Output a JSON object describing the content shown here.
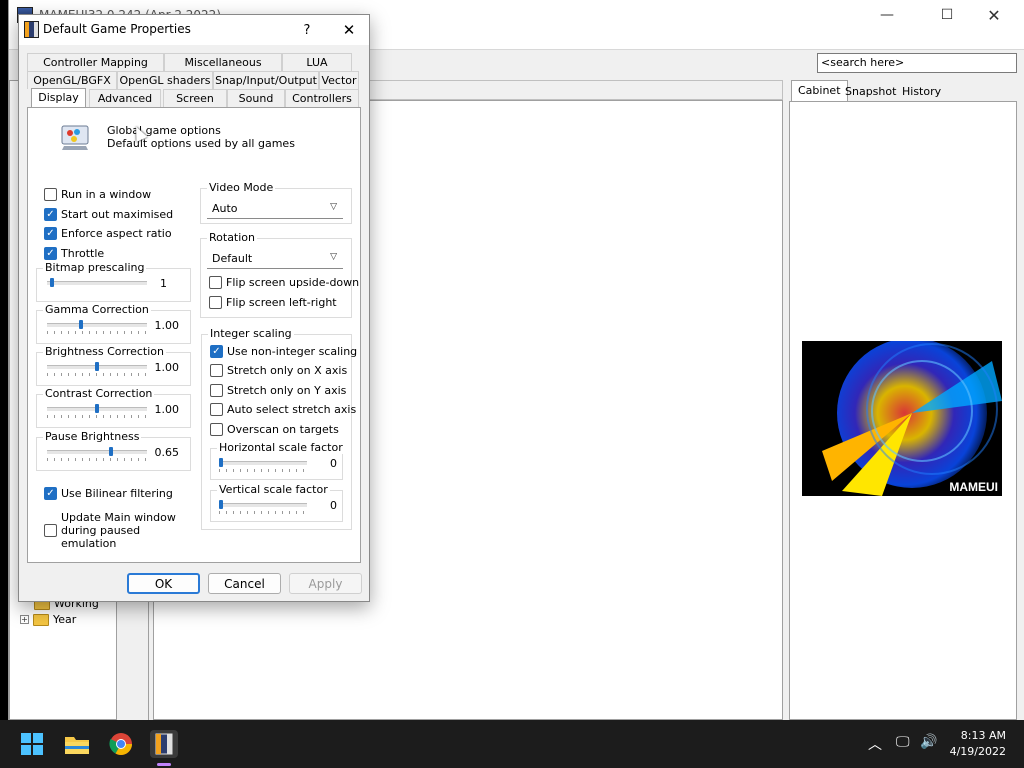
{
  "main_window": {
    "title": "MAMEUI32 0.242 (Apr 2 2022)",
    "search_placeholder": "<search here>",
    "tree_items": [
      "Working",
      "Year"
    ],
    "right_tabs": [
      "Cabinet",
      "Snapshot",
      "History"
    ],
    "cabinet_label": "MAMEUI"
  },
  "dialog": {
    "title": "Default Game Properties",
    "help_glyph": "?",
    "close_glyph": "✕",
    "tabs_row1": [
      "Controller Mapping",
      "Miscellaneous",
      "LUA"
    ],
    "tabs_row2": [
      "OpenGL/BGFX",
      "OpenGL shaders",
      "Snap/Input/Output",
      "Vector"
    ],
    "tabs_row3": [
      "Display",
      "Advanced",
      "Screen",
      "Sound",
      "Controllers"
    ],
    "header_line1": "Global game options",
    "header_line2": "Default options used by all games",
    "checks_left": [
      {
        "label": "Run in a window",
        "checked": false
      },
      {
        "label": "Start out maximised",
        "checked": true
      },
      {
        "label": "Enforce aspect ratio",
        "checked": true
      },
      {
        "label": "Throttle",
        "checked": true
      }
    ],
    "sliders_left": [
      {
        "label": "Bitmap prescaling",
        "value": "1",
        "level": 0.03
      },
      {
        "label": "Gamma Correction",
        "value": "1.00",
        "level": 0.33
      },
      {
        "label": "Brightness Correction",
        "value": "1.00",
        "level": 0.5
      },
      {
        "label": "Contrast Correction",
        "value": "1.00",
        "level": 0.5
      },
      {
        "label": "Pause Brightness",
        "value": "0.65",
        "level": 0.65
      }
    ],
    "bilinear": {
      "label": "Use Bilinear filtering",
      "checked": true
    },
    "update_main": {
      "lines": [
        "Update Main window",
        "during paused",
        "emulation"
      ],
      "checked": false
    },
    "video_mode": {
      "label": "Video Mode",
      "value": "Auto"
    },
    "rotation": {
      "label": "Rotation",
      "value": "Default",
      "checks": [
        {
          "label": "Flip screen upside-down",
          "checked": false
        },
        {
          "label": "Flip screen left-right",
          "checked": false
        }
      ]
    },
    "integer_scaling": {
      "label": "Integer scaling",
      "checks": [
        {
          "label": "Use non-integer scaling",
          "checked": true
        },
        {
          "label": "Stretch only on X axis",
          "checked": false
        },
        {
          "label": "Stretch only on Y axis",
          "checked": false
        },
        {
          "label": "Auto select stretch axis",
          "checked": false
        },
        {
          "label": "Overscan on targets",
          "checked": false
        }
      ],
      "horizontal": {
        "label": "Horizontal scale factor",
        "value": "0",
        "level": 0.0
      },
      "vertical": {
        "label": "Vertical scale factor",
        "value": "0",
        "level": 0.0
      }
    },
    "buttons": {
      "ok": "OK",
      "cancel": "Cancel",
      "apply": "Apply"
    }
  },
  "taskbar": {
    "time": "8:13 AM",
    "date": "4/19/2022"
  },
  "colors": {
    "accent": "#1f6fc4",
    "taskbar": "#1c1c1c"
  }
}
